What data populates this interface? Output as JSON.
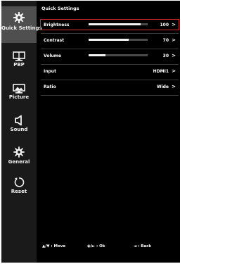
{
  "sidebar": {
    "items": [
      {
        "label": "Quick Settings",
        "icon": "quick-settings-gear-icon",
        "active": true
      },
      {
        "label": "PBP",
        "icon": "pbp-monitor-icon",
        "active": false
      },
      {
        "label": "Picture",
        "icon": "picture-monitor-icon",
        "active": false
      },
      {
        "label": "Sound",
        "icon": "speaker-icon",
        "active": false
      },
      {
        "label": "General",
        "icon": "gear-icon",
        "active": false
      },
      {
        "label": "Reset",
        "icon": "reset-icon",
        "active": false
      }
    ]
  },
  "panel": {
    "title": "Quick Settings",
    "rows": [
      {
        "label": "Brightness",
        "value": "100",
        "level": 0.88,
        "arrow": ">"
      },
      {
        "label": "Contrast",
        "value": "70",
        "level": 0.68,
        "arrow": ">"
      },
      {
        "label": "Volume",
        "value": "30",
        "level": 0.28,
        "arrow": ">"
      },
      {
        "label": "Input",
        "value": "HDMI1",
        "arrow": ">"
      },
      {
        "label": "Ratio",
        "value": "Wide",
        "arrow": ">"
      }
    ]
  },
  "footer": {
    "move": "▲/▼ : Move",
    "ok": "◉/► : Ok",
    "back": "◄ : Back"
  },
  "colors": {
    "highlight": "#d42a2a",
    "active_bg": "#4f4f4f",
    "background": "#000000"
  }
}
